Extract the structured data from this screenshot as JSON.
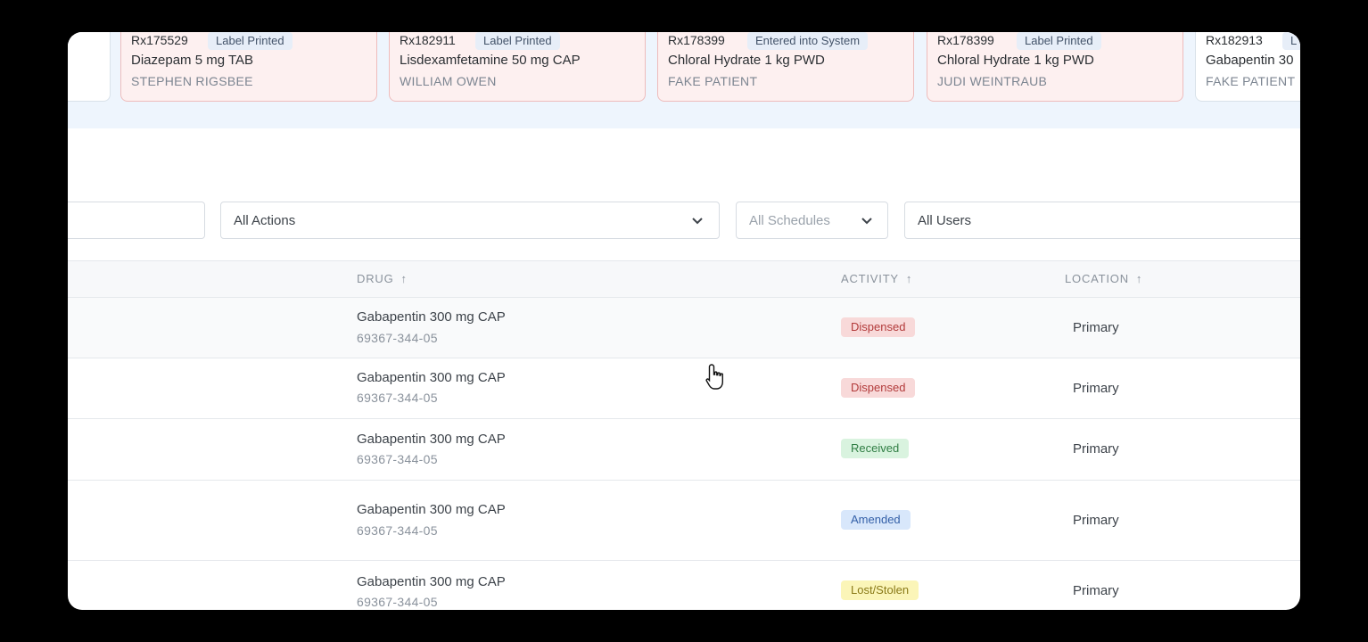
{
  "prescription_cards": [
    {
      "rx": "Rx175529",
      "status": "Label Printed",
      "drug": "Diazepam 5 mg TAB",
      "patient": "STEPHEN RIGSBEE"
    },
    {
      "rx": "Rx182911",
      "status": "Label Printed",
      "drug": "Lisdexamfetamine 50 mg CAP",
      "patient": "WILLIAM OWEN"
    },
    {
      "rx": "Rx178399",
      "status": "Entered into System",
      "drug": "Chloral Hydrate 1 kg PWD",
      "patient": "FAKE PATIENT"
    },
    {
      "rx": "Rx178399",
      "status": "Label Printed",
      "drug": "Chloral Hydrate 1 kg PWD",
      "patient": "JUDI WEINTRAUB"
    },
    {
      "rx": "Rx182913",
      "status": "L",
      "drug": "Gabapentin 30",
      "patient": "FAKE PATIENT"
    }
  ],
  "filters": {
    "actions": "All Actions",
    "schedules": "All Schedules",
    "users": "All Users"
  },
  "table": {
    "headers": {
      "drug": "DRUG",
      "activity": "ACTIVITY",
      "location": "LOCATION"
    },
    "rows": [
      {
        "drug": "Gabapentin 300 mg CAP",
        "ndc": "69367-344-05",
        "activity": "Dispensed",
        "location": "Primary"
      },
      {
        "drug": "Gabapentin 300 mg CAP",
        "ndc": "69367-344-05",
        "activity": "Dispensed",
        "location": "Primary"
      },
      {
        "drug": "Gabapentin 300 mg CAP",
        "ndc": "69367-344-05",
        "activity": "Received",
        "location": "Primary"
      },
      {
        "drug": "Gabapentin 300 mg CAP",
        "ndc": "69367-344-05",
        "activity": "Amended",
        "location": "Primary"
      },
      {
        "drug": "Gabapentin 300 mg CAP",
        "ndc": "69367-344-05",
        "activity": "Lost/Stolen",
        "location": "Primary"
      }
    ]
  },
  "icons": {
    "sort": "arrow-up-icon",
    "dropdown": "chevron-down-icon",
    "cursor": "hand-pointer-icon"
  },
  "colors": {
    "dispensed": "#f8d9d9",
    "received": "#d9f3df",
    "amended": "#d8e7fb",
    "lost_stolen": "#fbf5b8"
  }
}
